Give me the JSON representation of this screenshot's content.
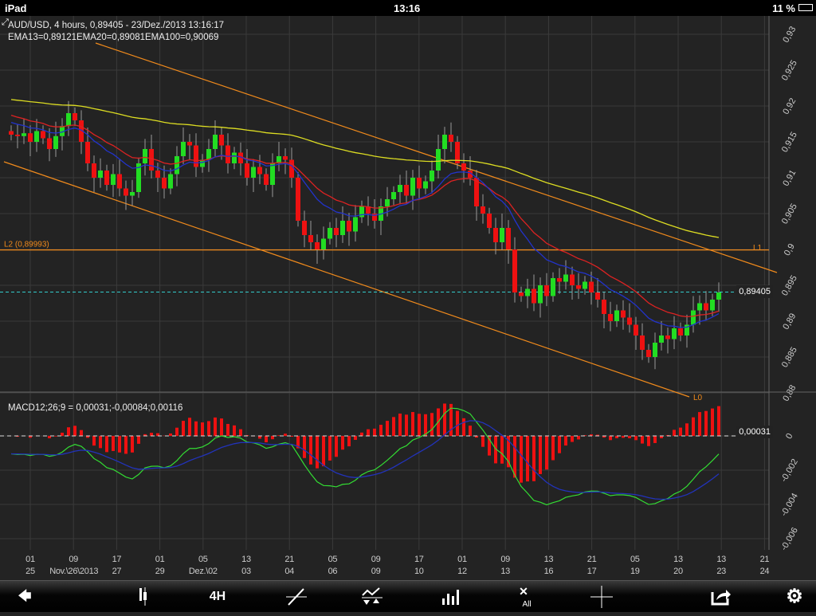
{
  "status": {
    "device": "iPad",
    "time": "13:16",
    "battery": "11 %"
  },
  "header": {
    "title": "AUD/USD, 4 hours, 0,89405 - 23/Dez./2013 13:16:17",
    "ema": "EMA13=0,89121EMA20=0,89081EMA100=0,90069"
  },
  "macd": {
    "title": "MACD12;26;9 = 0,00031;-0,00084;0,00116",
    "current_label": "0,00031",
    "yticks": [
      "0",
      "-0,002",
      "-0,004",
      "-0,006"
    ]
  },
  "price": {
    "current_label": "0,89405",
    "current": 0.89405,
    "yticks": [
      "0,93",
      "0,925",
      "0,92",
      "0,915",
      "0,91",
      "0,905",
      "0,9",
      "0,895",
      "0,89",
      "0,885",
      "0,88"
    ]
  },
  "lines": {
    "l2_label": "L2 (0,89993)",
    "l2_value": 0.89993,
    "l1_label": "L1",
    "l0_label": "L0"
  },
  "colors": {
    "up": "#22dd22",
    "down": "#ee1111",
    "ema13": "#2233cc",
    "ema20": "#dd2222",
    "ema100": "#dddd22",
    "channel": "#f08a1c",
    "macd": "#33dd33",
    "signal": "#2233bb",
    "hist": "#ee1111"
  },
  "xaxis": [
    [
      "01",
      "25"
    ],
    [
      "09",
      "Nov.\\26\\2013"
    ],
    [
      "17",
      "27"
    ],
    [
      "01",
      "29"
    ],
    [
      "05",
      "Dez.\\02"
    ],
    [
      "13",
      "03"
    ],
    [
      "21",
      "04"
    ],
    [
      "05",
      "06"
    ],
    [
      "09",
      "09"
    ],
    [
      "17",
      "10"
    ],
    [
      "01",
      "12"
    ],
    [
      "09",
      "13"
    ],
    [
      "13",
      "16"
    ],
    [
      "21",
      "17"
    ],
    [
      "05",
      "19"
    ],
    [
      "13",
      "20"
    ],
    [
      "13",
      "23"
    ],
    [
      "21",
      "24"
    ]
  ],
  "toolbar": {
    "back": "back",
    "candles": "candle-type",
    "period": "4H",
    "trendline": "draw-line",
    "indicators": "indicators",
    "volume": "volume",
    "clear_label": "All",
    "crosshair": "crosshair",
    "share": "share",
    "settings": "settings"
  },
  "chart_data": {
    "type": "candlestick",
    "closes": [
      0.916,
      0.9158,
      0.9162,
      0.915,
      0.9165,
      0.9155,
      0.914,
      0.9158,
      0.9172,
      0.919,
      0.918,
      0.915,
      0.912,
      0.91,
      0.911,
      0.909,
      0.9105,
      0.9085,
      0.9075,
      0.908,
      0.912,
      0.914,
      0.911,
      0.91,
      0.9085,
      0.9105,
      0.913,
      0.915,
      0.9145,
      0.9115,
      0.9125,
      0.914,
      0.916,
      0.9145,
      0.912,
      0.9135,
      0.912,
      0.91,
      0.9115,
      0.9105,
      0.909,
      0.912,
      0.913,
      0.9125,
      0.91,
      0.904,
      0.902,
      0.901,
      0.9,
      0.9015,
      0.903,
      0.902,
      0.904,
      0.9025,
      0.9045,
      0.906,
      0.905,
      0.904,
      0.906,
      0.907,
      0.908,
      0.909,
      0.9075,
      0.91,
      0.9085,
      0.9095,
      0.911,
      0.914,
      0.916,
      0.915,
      0.912,
      0.911,
      0.91,
      0.906,
      0.905,
      0.903,
      0.901,
      0.903,
      0.9,
      0.894,
      0.8935,
      0.8945,
      0.8925,
      0.895,
      0.8935,
      0.896,
      0.8955,
      0.8965,
      0.895,
      0.8945,
      0.8955,
      0.894,
      0.893,
      0.891,
      0.89,
      0.8915,
      0.8905,
      0.8895,
      0.888,
      0.886,
      0.885,
      0.887,
      0.888,
      0.8875,
      0.889,
      0.888,
      0.8895,
      0.8915,
      0.8925,
      0.8915,
      0.893,
      0.894
    ],
    "ylim": [
      0.88,
      0.93
    ],
    "macd_ylim": [
      -0.0065,
      0.0015
    ]
  }
}
